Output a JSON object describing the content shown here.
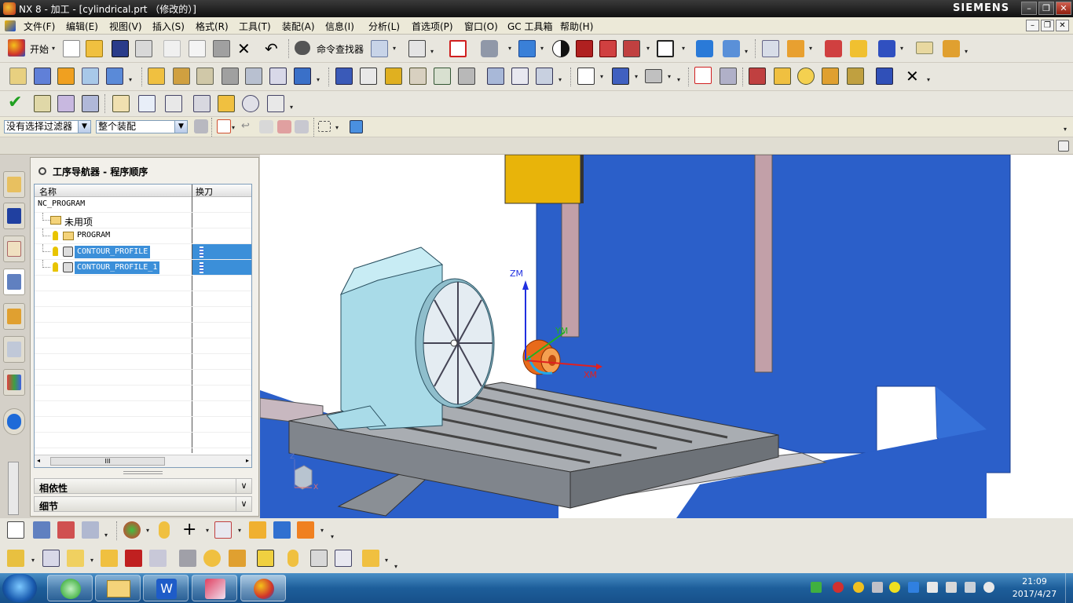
{
  "window": {
    "title": "NX 8 - 加工 - [cylindrical.prt （修改的）]",
    "brand": "SIEMENS",
    "controls": [
      "–",
      "❐",
      "✕"
    ]
  },
  "menu": {
    "items": [
      "文件(F)",
      "编辑(E)",
      "视图(V)",
      "插入(S)",
      "格式(R)",
      "工具(T)",
      "装配(A)",
      "信息(I)",
      "分析(L)",
      "首选项(P)",
      "窗口(O)",
      "GC 工具箱",
      "帮助(H)"
    ],
    "mdi_controls": [
      "–",
      "❐",
      "✕"
    ]
  },
  "toolbar": {
    "start_label": "开始",
    "command_finder_label": "命令查找器"
  },
  "filterbar": {
    "filter_value": "没有选择过滤器",
    "scope_value": "整个装配"
  },
  "navigator": {
    "title": "工序导航器 - 程序顺序",
    "columns": {
      "name": "名称",
      "tool_change": "换刀"
    },
    "rows": [
      {
        "name": "NC_PROGRAM"
      },
      {
        "name": "未用项"
      },
      {
        "name": "PROGRAM"
      },
      {
        "name": "CONTOUR_PROFILE"
      },
      {
        "name": "CONTOUR_PROFILE_1"
      }
    ],
    "scroll_thumb": "III",
    "sections": [
      {
        "label": "相依性",
        "chevron": "∨"
      },
      {
        "label": "细节",
        "chevron": "∨"
      }
    ]
  },
  "viewport": {
    "axis_labels": {
      "zm": "ZM",
      "ym": "YM",
      "xm": "XM"
    },
    "triad": {
      "z": "Z",
      "x": "X"
    }
  },
  "taskbar": {
    "time": "21:09",
    "date": "2017/4/27"
  },
  "colors": {
    "selection": "#3b8fd9",
    "machine_blue": "#2b5fc9",
    "fixture_cyan": "#a9dbe8",
    "table_gray": "#8c9095",
    "spindle_yellow": "#e8b40a",
    "part_orange": "#e86a1a"
  }
}
